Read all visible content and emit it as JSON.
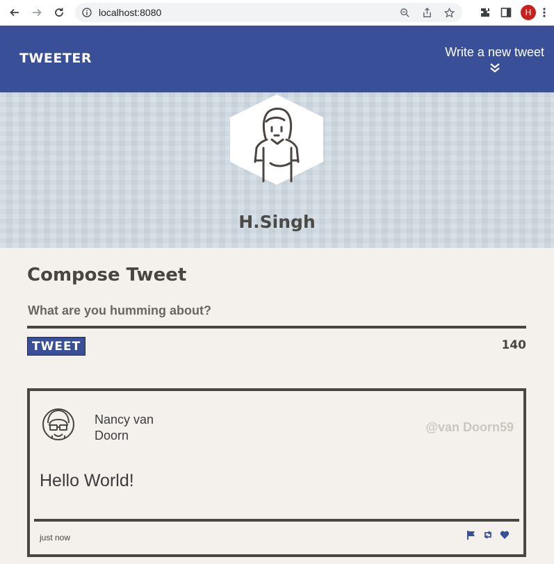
{
  "browser": {
    "url": "localhost:8080",
    "profile_initial": "H"
  },
  "nav": {
    "brand": "TWEETER",
    "write_label": "Write a new tweet"
  },
  "profile": {
    "name": "H.Singh"
  },
  "compose": {
    "title": "Compose Tweet",
    "placeholder": "What are you humming about?",
    "button_label": "TWEET",
    "counter": "140"
  },
  "tweet": {
    "name": "Nancy van Doorn",
    "handle": "@van Doorn59",
    "body": "Hello World!",
    "time": "just now"
  },
  "colors": {
    "nav": "#394f97",
    "banner": "#d2dce3",
    "page": "#f4f1ec",
    "text": "#4a4540"
  }
}
